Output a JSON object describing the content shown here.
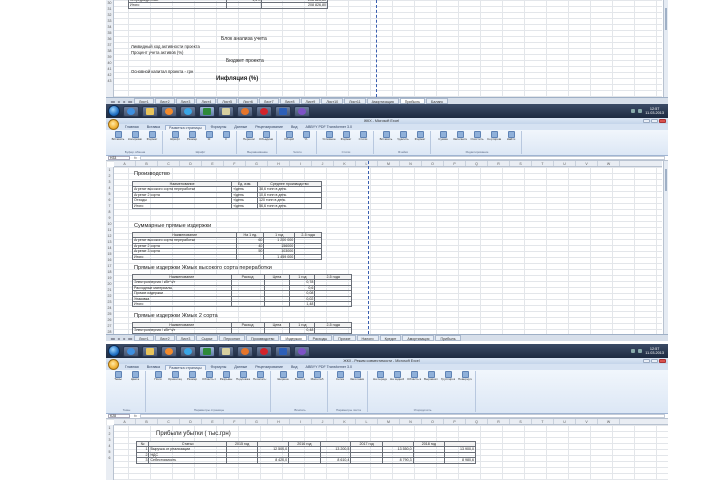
{
  "taskbar": {
    "clock_time": "12:57",
    "clock_date": "11.03.2013"
  },
  "shot1": {
    "top_rows": [
      {
        "label": "непредвиденные",
        "value": "1,5%",
        "amount": "208 826,80"
      },
      {
        "label": "Итого",
        "value": "",
        "amount": "208 826,80"
      }
    ],
    "section_title": "Блок анализа учета",
    "lines": [
      "Ликвидный ход активности проекта",
      "Процент учета активов (%)"
    ],
    "section_title_2": "Бюджет проекта",
    "line_3": "Основной капитал проекта - грн",
    "section_title_3": "Инфляция (%)",
    "sheet_tabs": [
      "Лист1",
      "Лист2",
      "Лист3",
      "Лист4",
      "Лист5",
      "Лист6",
      "Лист7",
      "Лист8",
      "Лист9",
      "Лист10",
      "Лист11",
      "Амортизация",
      "Прибыль",
      "Баланс"
    ],
    "row_numbers": [
      "30",
      "31",
      "32",
      "33",
      "34",
      "35",
      "36",
      "37",
      "38",
      "39",
      "40",
      "41",
      "42",
      "43"
    ]
  },
  "shot2": {
    "title_bar": "ЖКХ - Microsoft Excel",
    "ribbon_tabs": [
      "Главная",
      "Вставка",
      "Разметка страницы",
      "Формулы",
      "Данные",
      "Рецензирование",
      "Вид",
      "ABBYY PDF Transformer 3.0"
    ],
    "ribbon_groups": [
      {
        "label": "Буфер обмена",
        "buttons": [
          "Вставить",
          "Копировать",
          "Формат"
        ]
      },
      {
        "label": "Шрифт",
        "buttons": [
          "Шрифт",
          "Размер",
          "Ж",
          "К"
        ]
      },
      {
        "label": "Выравнивание",
        "buttons": [
          "Перенос",
          "Объединить"
        ]
      },
      {
        "label": "Число",
        "buttons": [
          "Общий",
          "%"
        ]
      },
      {
        "label": "Стили",
        "buttons": [
          "Условное",
          "Формат",
          "Стили"
        ]
      },
      {
        "label": "Ячейки",
        "buttons": [
          "Вставить",
          "Удалить",
          "Формат"
        ]
      },
      {
        "label": "Редактирование",
        "buttons": [
          "Сумма",
          "Заполнить",
          "Очистить",
          "Сортировка",
          "Найти"
        ]
      }
    ],
    "name_box": "H33",
    "section_1_title": "Производство",
    "table_1": {
      "head": [
        "Наименование",
        "Ед. изм.",
        "Среднее производство"
      ],
      "rows": [
        [
          "Агрегат высокого сорта переработки",
          "т/день",
          "38,6 тонн в день"
        ],
        [
          "Агрегат 2 сорта",
          "т/день",
          "10,6 тонн в день"
        ],
        [
          "Отходы",
          "т/день",
          "120 тонн в день"
        ],
        [
          "Итого",
          "т/день",
          "56,6 тонн в день"
        ]
      ]
    },
    "section_2_title": "Суммарные прямые издержки",
    "table_2": {
      "head": [
        "Наименование",
        "На 1 ед.",
        "1 год",
        "2-5 года"
      ],
      "rows": [
        [
          "Агрегат высокого сорта переработки",
          "60",
          "1 200 000",
          ""
        ],
        [
          "Агрегат 2 сорта",
          "40",
          "156000",
          ""
        ],
        [
          "Агрегат 3 сорта",
          "50",
          "103000",
          ""
        ],
        [
          "Итого",
          "",
          "1 459 000",
          ""
        ]
      ]
    },
    "section_3_title": "Прямые издержки Жмых высокого сорта переработки",
    "table_3": {
      "head": [
        "Наименование",
        "Расход",
        "Цена",
        "1 год",
        "2-5 года"
      ],
      "rows": [
        [
          "Электроэнергия / кВт*ч/т",
          "",
          "",
          "0,78",
          ""
        ],
        [
          "Расходные материалы",
          "",
          "",
          "0,6",
          ""
        ],
        [
          "Прочие издержки",
          "",
          "",
          "0,08",
          ""
        ],
        [
          "Упаковка",
          "",
          "",
          "0,02",
          ""
        ],
        [
          "Итого",
          "",
          "",
          "1,48",
          ""
        ]
      ]
    },
    "section_4_title": "Прямые издержки Жмых 2 сорта",
    "table_4": {
      "head": [
        "Наименование",
        "Расход",
        "Цена",
        "1 год",
        "2-5 года"
      ],
      "rows": [
        [
          "Электроэнергия / кВт*ч/т",
          "",
          "",
          "0,48",
          ""
        ]
      ]
    },
    "sheet_tabs": [
      "Лист1",
      "Лист2",
      "Лист3",
      "Сырье",
      "Персонал",
      "Производство",
      "Издержки",
      "Расходы",
      "Прочие",
      "Налоги",
      "Кредит",
      "Амортизация",
      "Прибыль"
    ],
    "row_numbers": [
      "1",
      "2",
      "3",
      "4",
      "5",
      "6",
      "7",
      "8",
      "9",
      "10",
      "11",
      "12",
      "13",
      "14",
      "15",
      "16",
      "17",
      "18",
      "19",
      "20",
      "21",
      "22",
      "23",
      "24",
      "25",
      "26",
      "27",
      "28"
    ],
    "col_letters": [
      "A",
      "B",
      "C",
      "D",
      "E",
      "F",
      "G",
      "H",
      "I",
      "J",
      "K",
      "L",
      "M",
      "N",
      "O",
      "P",
      "Q",
      "R",
      "S",
      "T",
      "U",
      "V",
      "W"
    ]
  },
  "shot3": {
    "title_bar": "ЖКХ - Режим совместимости - Microsoft Excel",
    "ribbon_tabs": [
      "Главная",
      "Вставка",
      "Разметка страницы",
      "Формулы",
      "Данные",
      "Рецензирование",
      "Вид",
      "ABBYY PDF Transformer 3.0"
    ],
    "ribbon_groups": [
      {
        "label": "Темы",
        "buttons": [
          "Темы",
          "Цвета"
        ]
      },
      {
        "label": "Параметры страницы",
        "buttons": [
          "Поля",
          "Ориентация",
          "Размер",
          "Область печати",
          "Разрывы",
          "Подложка",
          "Печатать заголовки"
        ]
      },
      {
        "label": "Вписать",
        "buttons": [
          "Ширина",
          "Высота",
          "Масштаб"
        ]
      },
      {
        "label": "Параметры листа",
        "buttons": [
          "Сетка",
          "Заголовки"
        ]
      },
      {
        "label": "Упорядочить",
        "buttons": [
          "На передний план",
          "На задний план",
          "Область выделения",
          "Выровнять",
          "Группировать",
          "Повернуть"
        ]
      }
    ],
    "name_box": "K28",
    "zoom_value": "100%",
    "title": "Прибыли убытки ( тыс.грн)",
    "table": {
      "head": [
        "№",
        "Статьи",
        "2015 год",
        "",
        "2016 год",
        "",
        "2017 год",
        "",
        "2018 год",
        ""
      ],
      "rows": [
        [
          "1",
          "Выручка от реализации",
          "",
          "12 500,0",
          "",
          "13 200,5",
          "",
          "13 550,0",
          "",
          "13 900,0"
        ],
        [
          "2",
          "НДС",
          "",
          "",
          "",
          "",
          "",
          "",
          "",
          ""
        ],
        [
          "3",
          "Себестоимость",
          "",
          "8 420,0",
          "",
          "8 610,4",
          "",
          "8 790,3",
          "",
          "8 980,6"
        ]
      ]
    },
    "row_numbers": [
      "1",
      "2",
      "3",
      "4",
      "5",
      "6"
    ],
    "col_letters": [
      "A",
      "B",
      "C",
      "D",
      "E",
      "F",
      "G",
      "H",
      "I",
      "J",
      "K",
      "L",
      "M",
      "N",
      "O",
      "P",
      "Q",
      "R",
      "S",
      "T",
      "U",
      "V",
      "W"
    ]
  }
}
